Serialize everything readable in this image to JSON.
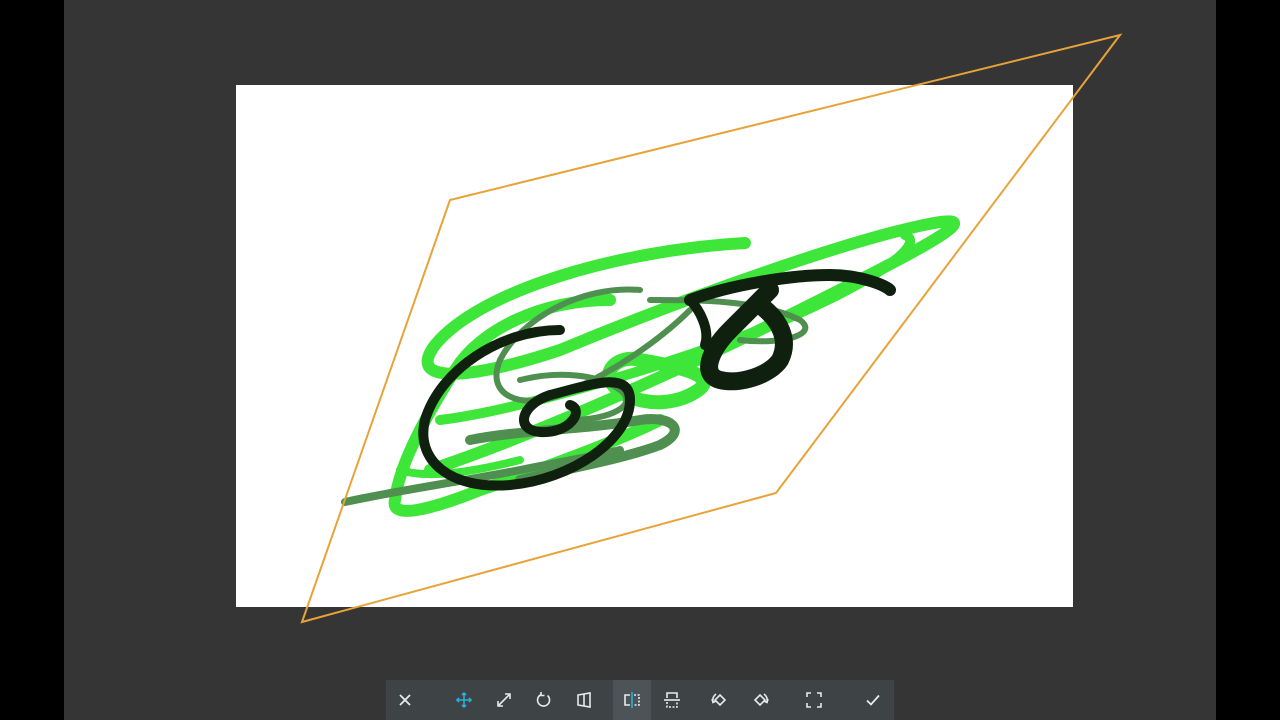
{
  "app": {
    "background_color": "#353535",
    "canvas_color": "#ffffff",
    "transform_frame_color": "#e8a23a"
  },
  "toolbar": {
    "background_color": "#3e4346",
    "icon_color": "#e8eaec",
    "accent_color": "#2ab0d8",
    "tools": [
      {
        "icon": "close-icon",
        "active": false
      },
      {
        "icon": "move-icon",
        "active": false,
        "highlighted": true
      },
      {
        "icon": "scale-icon",
        "active": false
      },
      {
        "icon": "rotate-icon",
        "active": false
      },
      {
        "icon": "perspective-icon",
        "active": false
      },
      {
        "icon": "flip-horizontal-icon",
        "active": true
      },
      {
        "icon": "flip-vertical-icon",
        "active": false
      },
      {
        "icon": "rotate-left-icon",
        "active": false
      },
      {
        "icon": "rotate-right-icon",
        "active": false
      },
      {
        "icon": "fit-screen-icon",
        "active": false
      },
      {
        "icon": "check-icon",
        "active": false
      }
    ]
  }
}
